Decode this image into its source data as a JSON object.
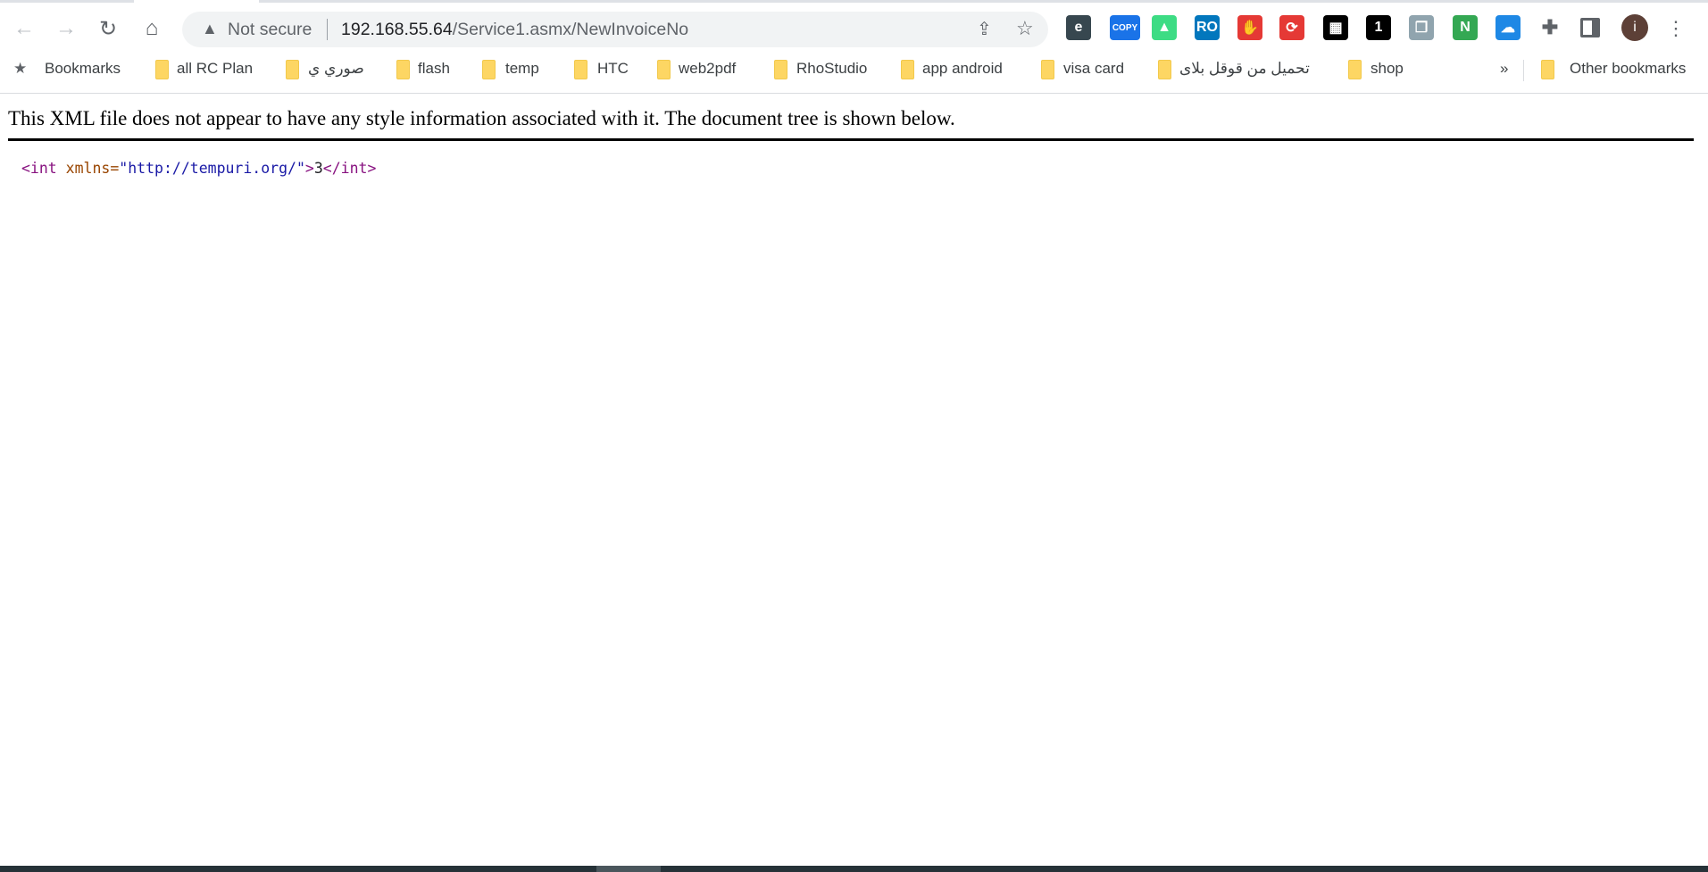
{
  "toolbar": {
    "back_icon": "arrow-left-icon",
    "forward_icon": "arrow-right-icon",
    "reload_icon": "reload-icon",
    "home_icon": "home-icon",
    "security_label": "Not secure",
    "url_host": "192.168.55.64",
    "url_path": "/Service1.asmx/NewInvoiceNo",
    "extensions": [
      {
        "name": "e-extension",
        "label": "e",
        "color": "#37474f"
      },
      {
        "name": "copy-extension",
        "label": "COPY",
        "color": "#1a73e8"
      },
      {
        "name": "android-extension",
        "label": "▲",
        "color": "#3ddc84"
      },
      {
        "name": "ro-extension",
        "label": "RO",
        "color": "#0277bd"
      },
      {
        "name": "adblock-extension",
        "label": "✋",
        "color": "#e53935"
      },
      {
        "name": "sync-extension",
        "label": "⟳",
        "color": "#e53935"
      },
      {
        "name": "qr-extension",
        "label": "▦",
        "color": "#000000"
      },
      {
        "name": "badge-extension",
        "label": "1",
        "color": "#000000"
      },
      {
        "name": "window-extension",
        "label": "❐",
        "color": "#90a4ae"
      },
      {
        "name": "n-extension",
        "label": "N",
        "color": "#34a853"
      },
      {
        "name": "cloud-download-extension",
        "label": "☁",
        "color": "#1e88e5"
      }
    ],
    "avatar_letter": "i",
    "avatar_color": "#5d4037"
  },
  "bookmarks": {
    "label": "Bookmarks",
    "items": [
      "all RC Plan",
      "صوري ي",
      "flash",
      "temp",
      "HTC",
      "web2pdf",
      "RhoStudio",
      "app android",
      "visa card",
      "تحميل من قوقل بلاى",
      "shop"
    ],
    "overflow": "»",
    "other": "Other bookmarks"
  },
  "page": {
    "message": "This XML file does not appear to have any style information associated with it. The document tree is shown below.",
    "xml": {
      "open_tag": "<int",
      "attr_name": " xmlns=",
      "attr_value": "\"http://tempuri.org/\"",
      "open_close": ">",
      "text": "3",
      "close_tag": "</int>"
    }
  }
}
